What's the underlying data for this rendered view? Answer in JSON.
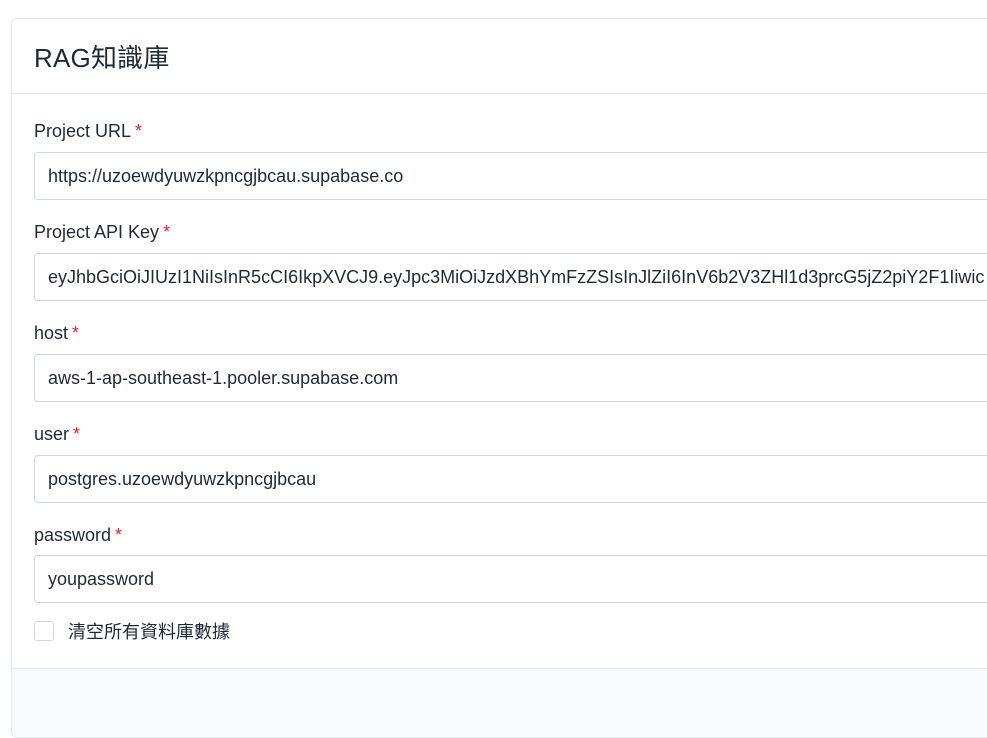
{
  "header": {
    "title": "RAG知識庫"
  },
  "form": {
    "project_url": {
      "label": "Project URL",
      "required_mark": "*",
      "value": "https://uzoewdyuwzkpncgjbcau.supabase.co"
    },
    "project_api_key": {
      "label": "Project API Key",
      "required_mark": "*",
      "value": "eyJhbGciOiJIUzI1NiIsInR5cCI6IkpXVCJ9.eyJpc3MiOiJzdXBhYmFzZSIsInJlZiI6InV6b2V3ZHl1d3prcG5jZ2piY2F1Iiwic"
    },
    "host": {
      "label": "host",
      "required_mark": "*",
      "value": "aws-1-ap-southeast-1.pooler.supabase.com"
    },
    "user": {
      "label": "user",
      "required_mark": "*",
      "value": "postgres.uzoewdyuwzkpncgjbcau"
    },
    "password": {
      "label": "password",
      "required_mark": "*",
      "value": "youpassword"
    },
    "clear_all": {
      "label": "清空所有資料庫數據",
      "checked": false
    }
  },
  "colors": {
    "required": "#dc2626",
    "border": "#d1d5db",
    "text": "#1f2937"
  }
}
